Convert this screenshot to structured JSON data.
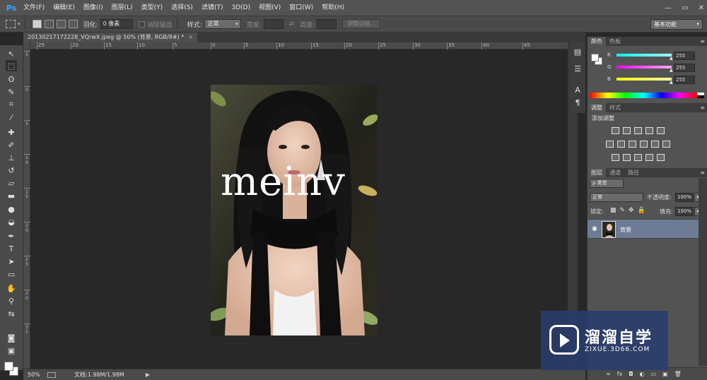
{
  "app": {
    "logo": "Ps"
  },
  "menu": [
    "文件(F)",
    "编辑(E)",
    "图像(I)",
    "图层(L)",
    "类型(Y)",
    "选择(S)",
    "滤镜(T)",
    "3D(D)",
    "视图(V)",
    "窗口(W)",
    "帮助(H)"
  ],
  "window_controls": {
    "minimize": "—",
    "restore": "▭",
    "close": "✕"
  },
  "options": {
    "feather_label": "羽化:",
    "feather_value": "0 像素",
    "antialias_label": "消除锯齿",
    "style_label": "样式:",
    "style_value": "正常",
    "width_label": "宽度:",
    "height_label": "高度:",
    "refine_edge": "调整边缘...",
    "workspace": "基本功能"
  },
  "document": {
    "tab_title": "20130217172228_VQrwX.jpeg @ 50% (背景, RGB/8#) *",
    "close": "×",
    "zoom": "50%",
    "doc_info": "文档:1.98M/1.98M",
    "overlay_text": "meinv"
  },
  "rulers": {
    "h": [
      "25",
      "20",
      "15",
      "10",
      "5",
      "0",
      "5",
      "10",
      "15",
      "20",
      "25",
      "30",
      "35",
      "40",
      "45"
    ],
    "v": [
      "5",
      "0",
      "5",
      "1 0",
      "1 5",
      "2 0",
      "2 5",
      "3 0",
      "3 5"
    ]
  },
  "panels": {
    "color_tabs": [
      "颜色",
      "色板"
    ],
    "rgb": [
      {
        "label": "R",
        "value": "255",
        "color": "#00e0e0"
      },
      {
        "label": "G",
        "value": "255",
        "color": "#e000e0"
      },
      {
        "label": "B",
        "value": "255",
        "color": "#e0e000"
      }
    ],
    "adjust_tabs": [
      "调整",
      "样式"
    ],
    "adjust_title": "添加调整",
    "layers_tabs": [
      "图层",
      "通道",
      "路径"
    ],
    "kind_filter": "ρ 类型",
    "blend_mode": "正常",
    "opacity_label": "不透明度:",
    "opacity_value": "100%",
    "lock_label": "锁定:",
    "fill_label": "填充:",
    "fill_value": "100%",
    "layer_name": "背景",
    "bottom_icons": [
      "∞",
      "fx",
      "◘",
      "◐",
      "▭",
      "▣",
      "🗑"
    ]
  },
  "watermark": {
    "name": "溜溜自学",
    "url": "ZIXUE.3D66.COM"
  },
  "colors": {
    "accent": "#31a8ff",
    "selected_layer": "#6d7c94"
  }
}
